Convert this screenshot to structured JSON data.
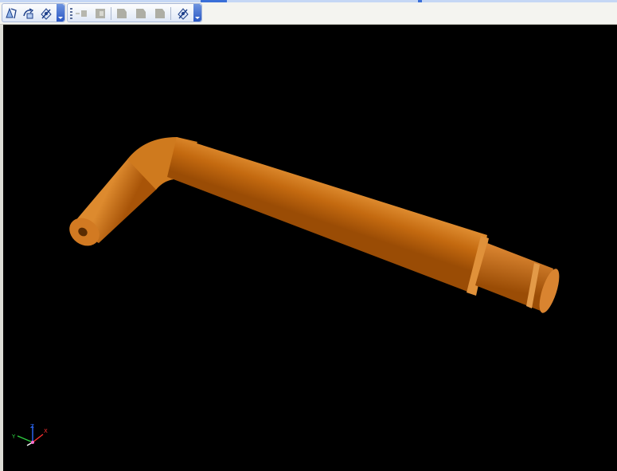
{
  "toolbar": {
    "groups": [
      {
        "name": "view-orientation",
        "buttons": [
          "rotate-view-icon",
          "pan-view-icon",
          "standard-views-icon"
        ]
      },
      {
        "name": "selection",
        "buttons": [
          "select-edge-icon",
          "select-face-icon",
          "select-body-icon",
          "select-part-icon",
          "select-feature-icon",
          "view-settings-icon"
        ]
      }
    ]
  },
  "viewport": {
    "background": "#000000",
    "model": {
      "part": "bent-rod",
      "color": "#c86a12"
    },
    "triad": {
      "axis_labels": {
        "y": "Y",
        "x": "X",
        "z": "Z"
      }
    }
  },
  "colors": {
    "accent": "#3a6fd8",
    "toolbar_bg": "#f4f4f0"
  }
}
